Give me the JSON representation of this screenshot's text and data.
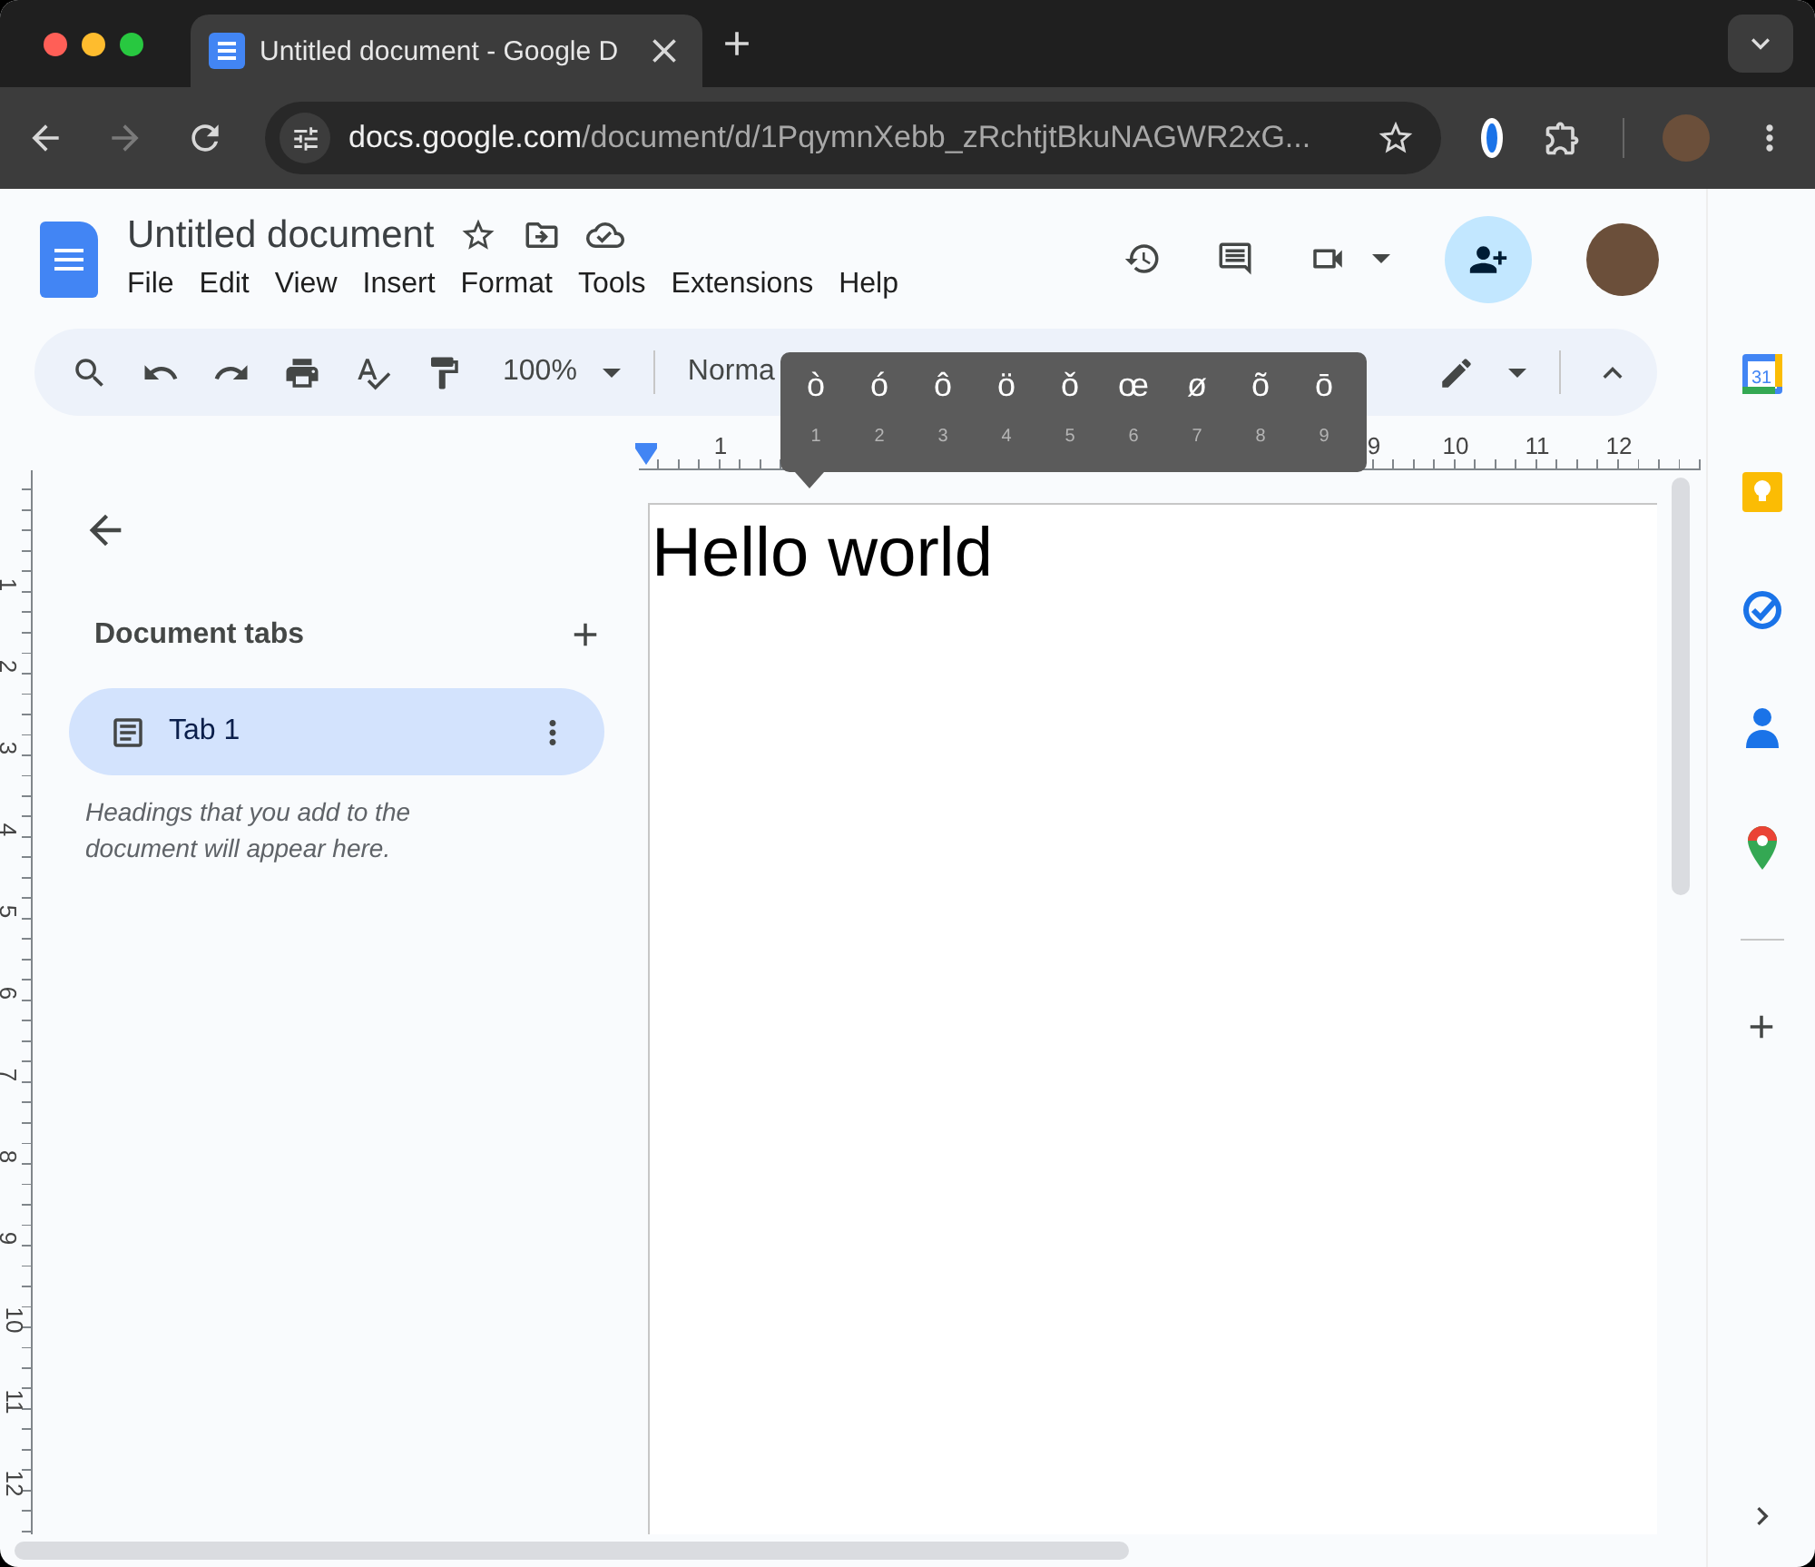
{
  "browser": {
    "tab": {
      "title": "Untitled document - Google D",
      "selected": true
    },
    "nav_buttons": [
      {
        "kind": "back",
        "disabled": false
      },
      {
        "kind": "forward",
        "disabled": true
      },
      {
        "kind": "reload",
        "disabled": false
      }
    ],
    "address": {
      "host": "docs.google.com",
      "path": "/document/d/1PqymnXebb_zRchtjtBkuNAGWR2xG..."
    }
  },
  "document": {
    "title": "Untitled document",
    "menu": [
      "File",
      "Edit",
      "View",
      "Insert",
      "Format",
      "Tools",
      "Extensions",
      "Help"
    ]
  },
  "toolbar": {
    "zoom": "100%",
    "style": "Norma"
  },
  "horizontal_ruler": {
    "start": [
      "1"
    ],
    "end": [
      "9",
      "10",
      "11",
      "12"
    ]
  },
  "vertical_ruler": [
    "1",
    "2",
    "3",
    "4",
    "5",
    "6",
    "7",
    "8",
    "9",
    "10",
    "11",
    "12"
  ],
  "sidebar": {
    "heading": "Document tabs",
    "tabs": [
      {
        "label": "Tab 1",
        "selected": true
      }
    ],
    "hint": "Headings that you add to the document will appear here."
  },
  "page": {
    "text": "Hello world"
  },
  "accent_picker": [
    {
      "char": "ò",
      "key": "1"
    },
    {
      "char": "ó",
      "key": "2"
    },
    {
      "char": "ô",
      "key": "3"
    },
    {
      "char": "ö",
      "key": "4"
    },
    {
      "char": "ǒ",
      "key": "5"
    },
    {
      "char": "œ",
      "key": "6"
    },
    {
      "char": "ø",
      "key": "7"
    },
    {
      "char": "õ",
      "key": "8"
    },
    {
      "char": "ō",
      "key": "9"
    }
  ],
  "side_panel": {
    "calendar_day": "31"
  }
}
